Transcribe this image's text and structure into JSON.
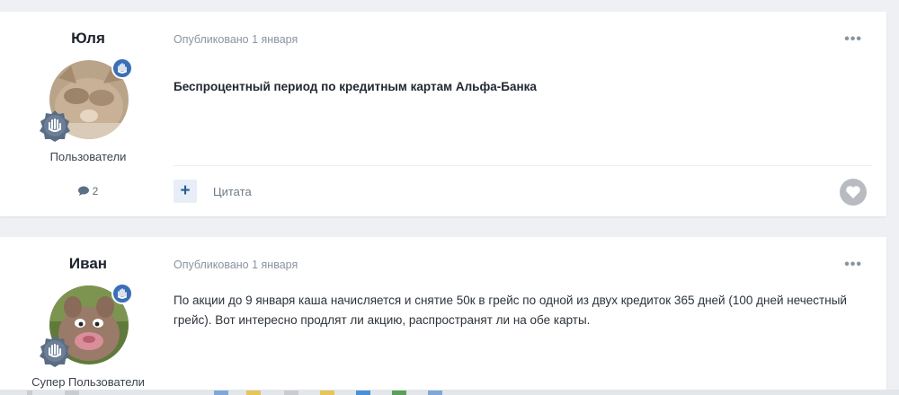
{
  "posts": [
    {
      "author": "Юля",
      "group": "Пользователи",
      "post_count": "2",
      "meta": "Опубликовано 1 января",
      "title": "Беспроцентный период по кредитным картам Альфа-Банка",
      "actions": {
        "quote_label": "Цитата",
        "plus_label": "+",
        "menu_label": "•••"
      }
    },
    {
      "author": "Иван",
      "group": "Супер Пользователи",
      "meta": "Опубликовано 1 января",
      "body": "По акции до 9 января каша начисляется и снятие 50к в грейс по одной из двух кредиток 365 дней (100 дней нечестный грейс). Вот интересно продлят ли акцию, распространят ли на обе карты.",
      "actions": {
        "menu_label": "•••"
      }
    }
  ],
  "colors": {
    "accent": "#3a6fb6",
    "page_bg": "#eef0f3",
    "card_bg": "#ffffff",
    "muted": "#8a94a0"
  },
  "icons": [
    "hand-badge-icon",
    "reputation-badge-icon",
    "comment-icon",
    "heart-icon",
    "more-icon"
  ]
}
